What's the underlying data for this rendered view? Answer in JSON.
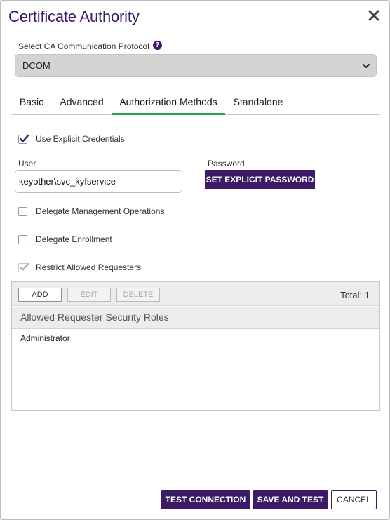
{
  "dialog": {
    "title": "Certificate Authority"
  },
  "protocol": {
    "label": "Select CA Communication Protocol",
    "help_glyph": "?",
    "selected": "DCOM"
  },
  "tabs": [
    {
      "label": "Basic",
      "active": false
    },
    {
      "label": "Advanced",
      "active": false
    },
    {
      "label": "Authorization Methods",
      "active": true
    },
    {
      "label": "Standalone",
      "active": false
    }
  ],
  "options": {
    "use_explicit_credentials": {
      "label": "Use Explicit Credentials",
      "checked": true
    },
    "delegate_management": {
      "label": "Delegate Management Operations",
      "checked": false
    },
    "delegate_enrollment": {
      "label": "Delegate Enrollment",
      "checked": false
    },
    "restrict_requesters": {
      "label": "Restrict Allowed Requesters",
      "checked": true,
      "disabled": true
    }
  },
  "user": {
    "label": "User",
    "value": "keyother\\svc_kyfservice"
  },
  "password": {
    "label": "Password",
    "button": "SET EXPLICIT PASSWORD"
  },
  "grid": {
    "add": "ADD",
    "edit": "EDIT",
    "delete": "DELETE",
    "total": "Total: 1",
    "column": "Allowed Requester Security Roles",
    "rows": [
      "Administrator"
    ]
  },
  "footer": {
    "test_connection": "TEST CONNECTION",
    "save_and_test": "SAVE AND TEST",
    "cancel": "CANCEL"
  },
  "colors": {
    "brand": "#3b1a66",
    "tab_active": "#2ea04a"
  }
}
